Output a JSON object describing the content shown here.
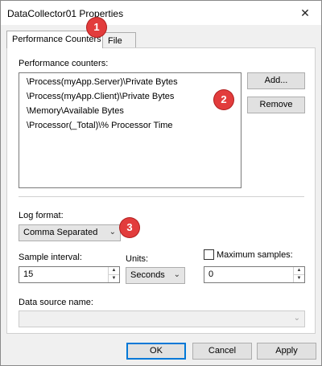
{
  "window": {
    "title": "DataCollector01 Properties",
    "close_icon": "close-icon"
  },
  "tabs": [
    {
      "label": "Performance Counters",
      "active": true
    },
    {
      "label": "File",
      "active": false
    }
  ],
  "counters": {
    "label": "Performance counters:",
    "items": [
      "\\Process(myApp.Server)\\Private Bytes",
      "\\Process(myApp.Client)\\Private Bytes",
      "\\Memory\\Available Bytes",
      "\\Processor(_Total)\\% Processor Time"
    ],
    "add_label": "Add...",
    "remove_label": "Remove"
  },
  "log_format": {
    "label": "Log format:",
    "value": "Comma Separated"
  },
  "sample_interval": {
    "label": "Sample interval:",
    "value": "15"
  },
  "units": {
    "label": "Units:",
    "value": "Seconds"
  },
  "max_samples": {
    "label": "Maximum samples:",
    "checked": false,
    "value": "0"
  },
  "data_source": {
    "label": "Data source name:",
    "value": ""
  },
  "footer": {
    "ok_label": "OK",
    "cancel_label": "Cancel",
    "apply_label": "Apply"
  },
  "callouts": [
    "1",
    "2",
    "3"
  ],
  "colors": {
    "callout": "#e23c3c",
    "focus_border": "#0078d7"
  }
}
